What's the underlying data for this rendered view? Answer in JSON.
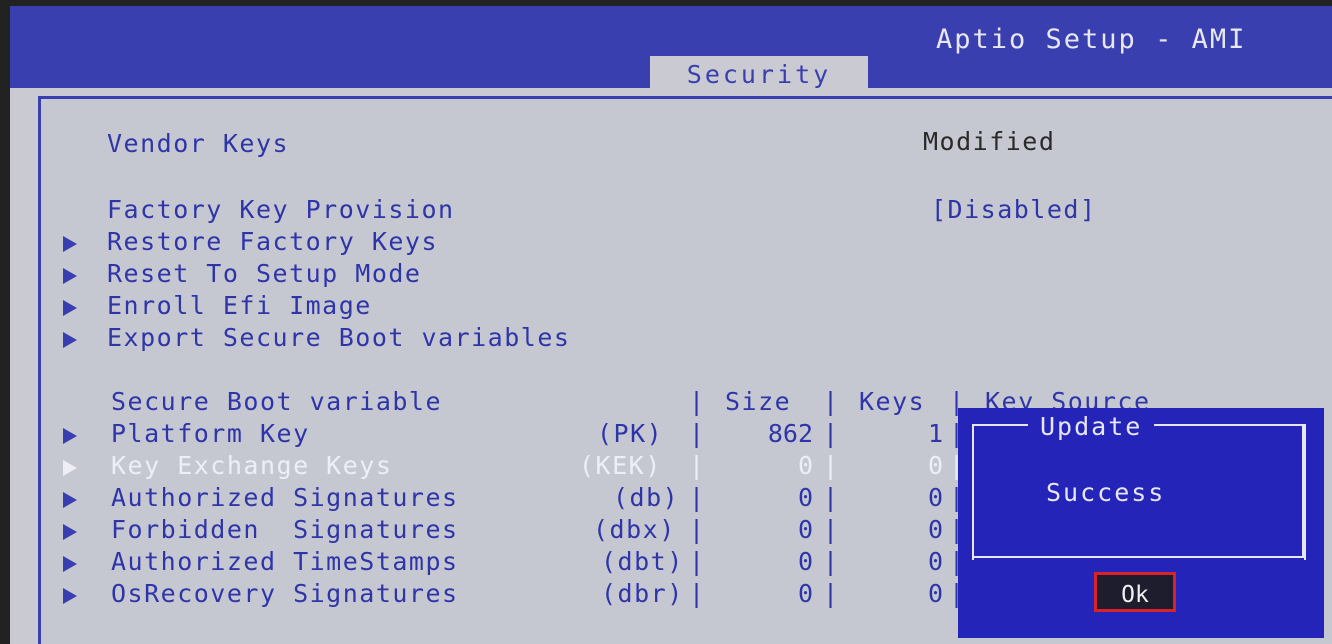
{
  "header": {
    "title": "Aptio Setup - AMI",
    "active_tab": "Security"
  },
  "vendor_keys": {
    "label": "Vendor Keys",
    "value": "Modified"
  },
  "factory_key_provision": {
    "label": "Factory Key Provision",
    "value": "[Disabled]"
  },
  "menu_items": [
    "Restore Factory Keys",
    "Reset To Setup Mode",
    "Enroll Efi Image",
    "Export Secure Boot variables"
  ],
  "table": {
    "headers": {
      "variable": "Secure Boot variable",
      "size": "Size",
      "keys": "Keys",
      "source": "Key Source"
    },
    "rows": [
      {
        "name": "Platform Key",
        "abbr": "(PK)",
        "size": "862",
        "keys": "1"
      },
      {
        "name": "Key Exchange Keys",
        "abbr": "(KEK)",
        "size": "0",
        "keys": "0"
      },
      {
        "name": "Authorized Signatures",
        "abbr": "(db)",
        "size": "0",
        "keys": "0"
      },
      {
        "name": "Forbidden  Signatures",
        "abbr": "(dbx)",
        "size": "0",
        "keys": "0"
      },
      {
        "name": "Authorized TimeStamps",
        "abbr": "(dbt)",
        "size": "0",
        "keys": "0"
      },
      {
        "name": "OsRecovery Signatures",
        "abbr": "(dbr)",
        "size": "0",
        "keys": "0"
      }
    ]
  },
  "dialog": {
    "title": "Update",
    "message": "Success",
    "ok_label": "Ok"
  }
}
